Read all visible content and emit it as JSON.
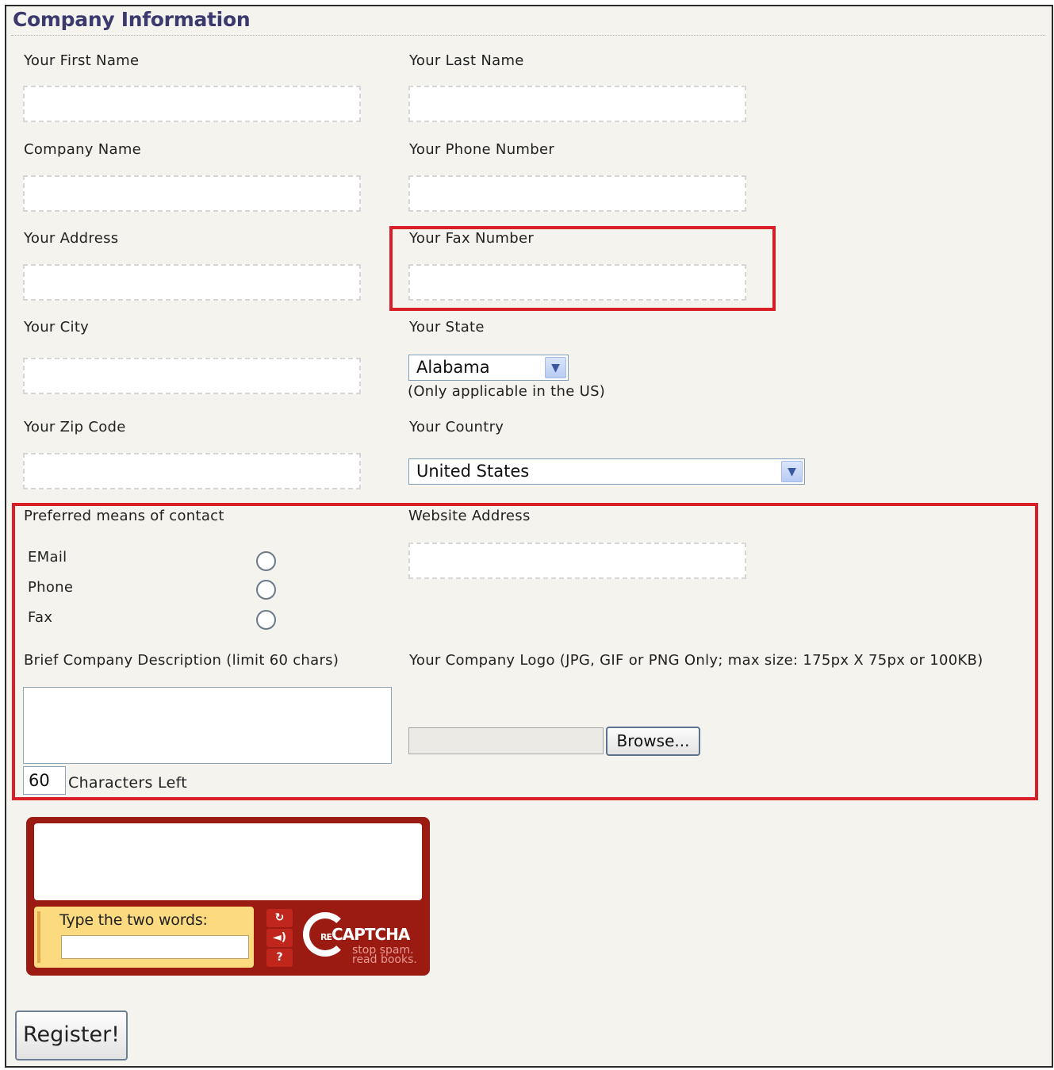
{
  "section_title": "Company Information",
  "fields": {
    "first_name_label": "Your First Name",
    "last_name_label": "Your Last Name",
    "company_name_label": "Company Name",
    "phone_label": "Your Phone Number",
    "address_label": "Your Address",
    "fax_label": "Your Fax Number",
    "city_label": "Your City",
    "state_label": "Your State",
    "state_value": "Alabama",
    "state_note": "(Only applicable in the US)",
    "zip_label": "Your Zip Code",
    "country_label": "Your Country",
    "country_value": "United States",
    "contact_label": "Preferred means of contact",
    "contact_options": [
      "EMail",
      "Phone",
      "Fax"
    ],
    "website_label": "Website Address",
    "description_label": "Brief Company Description (limit 60 chars)",
    "chars_left_value": "60",
    "chars_left_label": "Characters Left",
    "logo_label": "Your Company Logo (JPG, GIF or PNG Only; max size: 175px X 75px or 100KB)",
    "browse_label": "Browse..."
  },
  "captcha": {
    "prompt": "Type the two words:",
    "brand_prefix": "RE",
    "brand": "CAPTCHA",
    "tagline_1": "stop spam.",
    "tagline_2": "read books.",
    "refresh_icon": "↻",
    "audio_icon": "◄)",
    "help_icon": "?"
  },
  "register_label": "Register!",
  "highlight_color": "#d81f26"
}
